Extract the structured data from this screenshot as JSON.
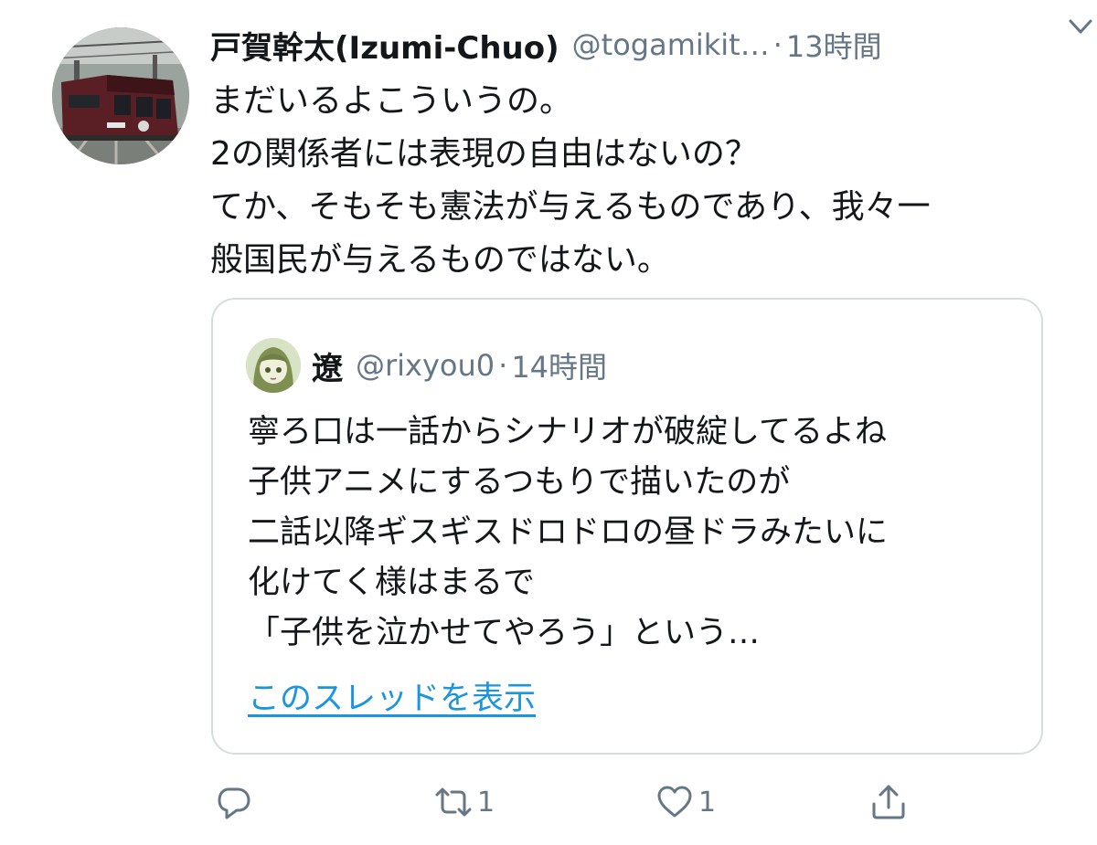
{
  "tweet": {
    "author": {
      "name": "戸賀幹太(Izumi-Chuo)",
      "handle": "@togamikit…",
      "separator": "·",
      "time": "13時間"
    },
    "text_lines": [
      "まだいるよこういうの。",
      "2の関係者には表現の自由はないの？",
      "てか、そもそも憲法が与えるものであり、我々一",
      "般国民が与えるものではない。"
    ],
    "menu_icon": "chevron-down-icon",
    "avatar_icon": "train-photo-avatar"
  },
  "quoted_tweet": {
    "author": {
      "name": "遼",
      "handle": "@rixyou0",
      "separator": "·",
      "time": "14時間"
    },
    "text_lines": [
      "寧ろ口は一話からシナリオが破綻してるよね",
      "子供アニメにするつもりで描いたのが",
      "二話以降ギスギスドロドロの昼ドラみたいに",
      "化けてく様はまるで",
      "「子供を泣かせてやろう」という…"
    ],
    "show_thread_label": "このスレッドを表示",
    "avatar_icon": "anime-character-avatar"
  },
  "actions": {
    "reply": {
      "icon": "reply-icon",
      "count": ""
    },
    "retweet": {
      "icon": "retweet-icon",
      "count": "1"
    },
    "like": {
      "icon": "heart-icon",
      "count": "1"
    },
    "share": {
      "icon": "share-icon",
      "count": ""
    }
  },
  "colors": {
    "text": "#14171a",
    "secondary": "#657786",
    "link": "#1b95e0",
    "border": "#d5dde2"
  }
}
